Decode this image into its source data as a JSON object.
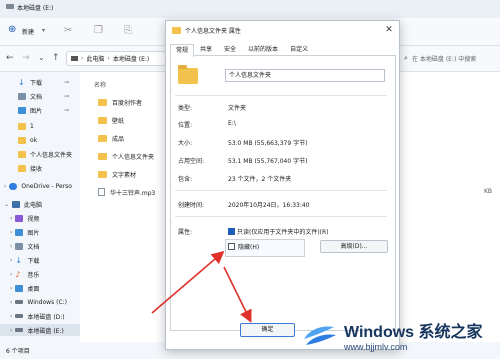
{
  "explorer": {
    "title": "本地磁盘 (E:)",
    "toolbar": {
      "new_label": "新建"
    },
    "address": {
      "path": [
        "此电脑",
        "本地磁盘 (E:)"
      ]
    },
    "search_placeholder": "在 本地磁盘 (E:) 中搜索",
    "column_header": "名称",
    "sidebar": [
      {
        "label": "下载",
        "icon": "download-icon",
        "pinned": true
      },
      {
        "label": "文档",
        "icon": "document-icon",
        "pinned": true
      },
      {
        "label": "图片",
        "icon": "picture-icon",
        "pinned": true
      },
      {
        "label": "1",
        "icon": "folder-icon",
        "pinned": false
      },
      {
        "label": "ok",
        "icon": "folder-icon",
        "pinned": false
      },
      {
        "label": "个人信息文件夹",
        "icon": "folder-icon",
        "pinned": false
      },
      {
        "label": "接收",
        "icon": "folder-icon",
        "pinned": false
      },
      {
        "label": "OneDrive - Perso",
        "icon": "cloud-icon",
        "pinned": false
      },
      {
        "label": "此电脑",
        "icon": "pc-icon",
        "pinned": false
      },
      {
        "label": "视频",
        "icon": "video-icon",
        "pinned": false
      },
      {
        "label": "图片",
        "icon": "picture-icon",
        "pinned": false
      },
      {
        "label": "文档",
        "icon": "document-icon",
        "pinned": false
      },
      {
        "label": "下载",
        "icon": "download-icon",
        "pinned": false
      },
      {
        "label": "音乐",
        "icon": "music-icon",
        "pinned": false
      },
      {
        "label": "桌面",
        "icon": "desktop-icon",
        "pinned": false
      },
      {
        "label": "Windows (C:)",
        "icon": "drive-icon",
        "pinned": false
      },
      {
        "label": "本地磁盘 (D:)",
        "icon": "drive-icon",
        "pinned": false
      },
      {
        "label": "本地磁盘 (E:)",
        "icon": "drive-icon",
        "pinned": false
      }
    ],
    "files": [
      {
        "name": "百度创作者"
      },
      {
        "name": "壁纸"
      },
      {
        "name": "成品"
      },
      {
        "name": "个人信息文件夹"
      },
      {
        "name": "文字素材"
      },
      {
        "name": "华十三铃声.mp3"
      }
    ],
    "right_size": "KB",
    "status": "6 个项目"
  },
  "dialog": {
    "title": "个人信息文件夹 属性",
    "tabs": [
      "常规",
      "共享",
      "安全",
      "以前的版本",
      "自定义"
    ],
    "folder_name": "个人信息文件夹",
    "rows": [
      {
        "label": "类型:",
        "value": "文件夹"
      },
      {
        "label": "位置:",
        "value": "E:\\"
      },
      {
        "label": "大小:",
        "value": "53.0 MB (55,663,379 字节)"
      },
      {
        "label": "占用空间:",
        "value": "53.1 MB (55,767,040 字节)"
      },
      {
        "label": "包含:",
        "value": "23 个文件，2 个文件夹"
      },
      {
        "label": "创建时间:",
        "value": "2020年10月24日，16:33:40"
      }
    ],
    "attributes_label": "属性:",
    "readonly_label": "只读(仅应用于文件夹中的文件)(R)",
    "hidden_label": "隐藏(H)",
    "advanced_label": "高级(D)...",
    "ok_label": "确定"
  },
  "watermark": {
    "title": "Windows 系统之家",
    "url": "www.bjjmlv.com"
  },
  "colors": {
    "accent": "#1f5eb8",
    "arrow": "#e0302a",
    "folder": "#f2c24d"
  }
}
